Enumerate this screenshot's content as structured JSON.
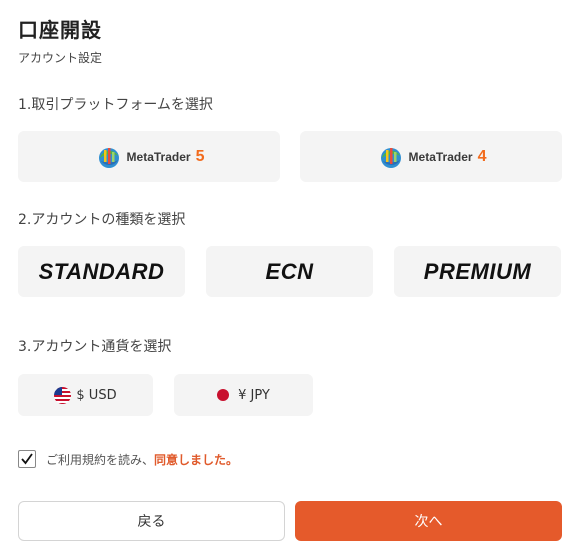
{
  "header": {
    "title": "口座開設",
    "subtitle": "アカウント設定"
  },
  "sections": {
    "platform_label": "1.取引プラットフォームを選択",
    "account_type_label": "2.アカウントの種類を選択",
    "currency_label": "3.アカウント通貨を選択"
  },
  "platforms": {
    "mt5": {
      "name": "MetaTrader",
      "version": "5"
    },
    "mt4": {
      "name": "MetaTrader",
      "version": "4"
    }
  },
  "account_types": {
    "standard": "STANDARD",
    "ecn": "ECN",
    "premium": "PREMIUM"
  },
  "currencies": {
    "usd": "$ USD",
    "jpy": "¥ JPY"
  },
  "agreement": {
    "text": "ご利用規約を読み、",
    "emphasis": "同意しました。",
    "checked": true
  },
  "buttons": {
    "back": "戻る",
    "next": "次へ"
  },
  "colors": {
    "accent": "#e55a2b",
    "option_bg": "#f4f4f4",
    "metatrader_orange": "#f26b1d"
  }
}
